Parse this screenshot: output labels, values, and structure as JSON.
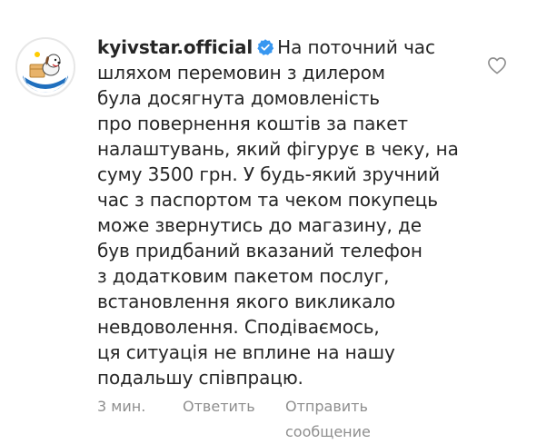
{
  "comment": {
    "username": "kyivstar.official",
    "first_line": "На поточний час",
    "lines": [
      "шляхом перемовин з дилером",
      "була досягнута домовленість",
      "про повернення коштів за пакет",
      "налаштувань, який фігурує в чеку, на",
      "суму 3500 грн. У будь-який зручний",
      "час з паспортом та чеком покупець",
      "може звернутись до магазину, де",
      "був придбаний вказаний телефон",
      "з додатковим пакетом послуг,",
      "встановлення якого викликало",
      "невдоволення. Сподіваємось,",
      "ця ситуація не вплине на нашу",
      "подальшу співпрацю."
    ]
  },
  "meta": {
    "time": "3 мин.",
    "reply_label": "Ответить",
    "send_label_line1": "Отправить",
    "send_label_line2": "сообщение"
  },
  "icons": {
    "verified": "verified-badge-icon",
    "like": "heart-outline-icon",
    "avatar": "kyivstar-dog-logo"
  },
  "colors": {
    "verified_blue": "#3897f0",
    "meta_gray": "#8e8e8e",
    "avatar_blue": "#1f6fbe",
    "logo_yellow": "#ffcc00"
  }
}
